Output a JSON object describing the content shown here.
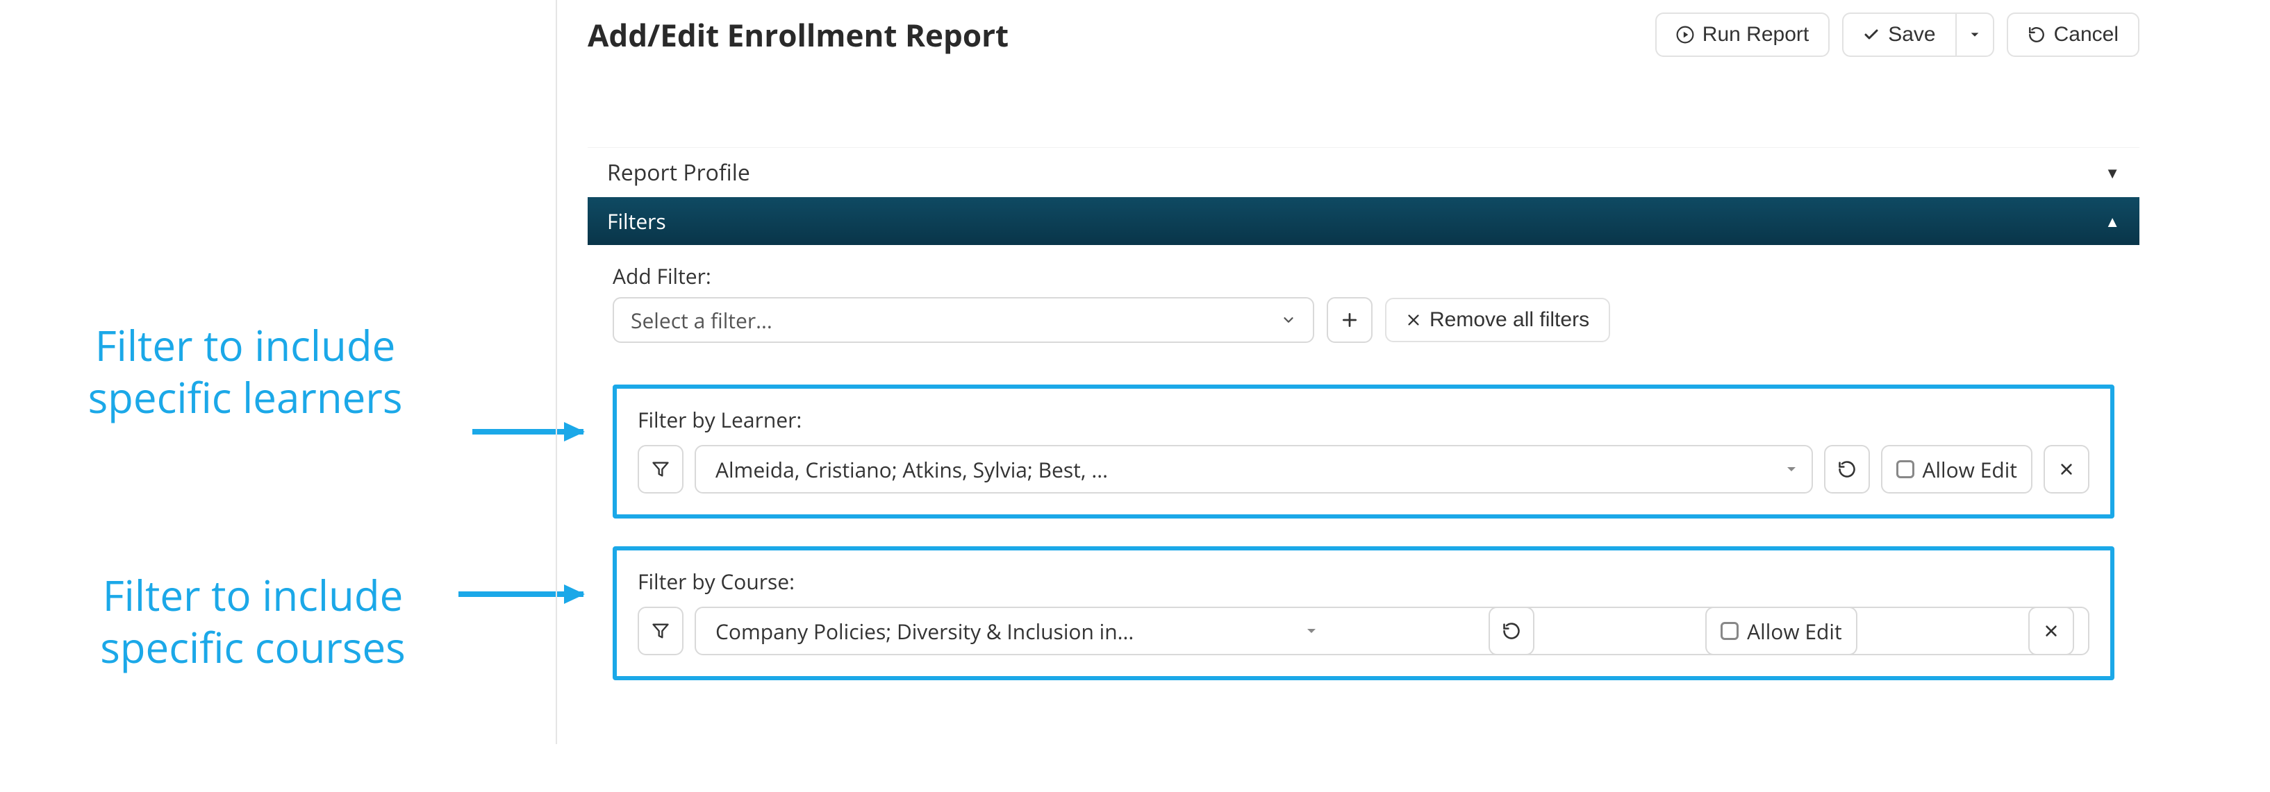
{
  "header": {
    "title": "Add/Edit Enrollment Report",
    "run_report": "Run Report",
    "save": "Save",
    "cancel": "Cancel"
  },
  "sections": {
    "profile_label": "Report Profile",
    "filters_label": "Filters"
  },
  "filters": {
    "add_filter_label": "Add Filter:",
    "select_placeholder": "Select a filter...",
    "remove_all": "Remove all filters",
    "cards": [
      {
        "title": "Filter by Learner:",
        "value": "Almeida, Cristiano; Atkins, Sylvia; Best, ...",
        "allow_edit_label": "Allow Edit"
      },
      {
        "title": "Filter by Course:",
        "value": "Company Policies; Diversity & Inclusion in...",
        "allow_edit_label": "Allow Edit"
      }
    ]
  },
  "annotations": {
    "learners_l1": "Filter to include",
    "learners_l2": "specific learners",
    "courses_l1": "Filter to include",
    "courses_l2": "specific courses"
  },
  "colors": {
    "accent": "#1ba8e8",
    "section_bg": "#0f4a63"
  }
}
